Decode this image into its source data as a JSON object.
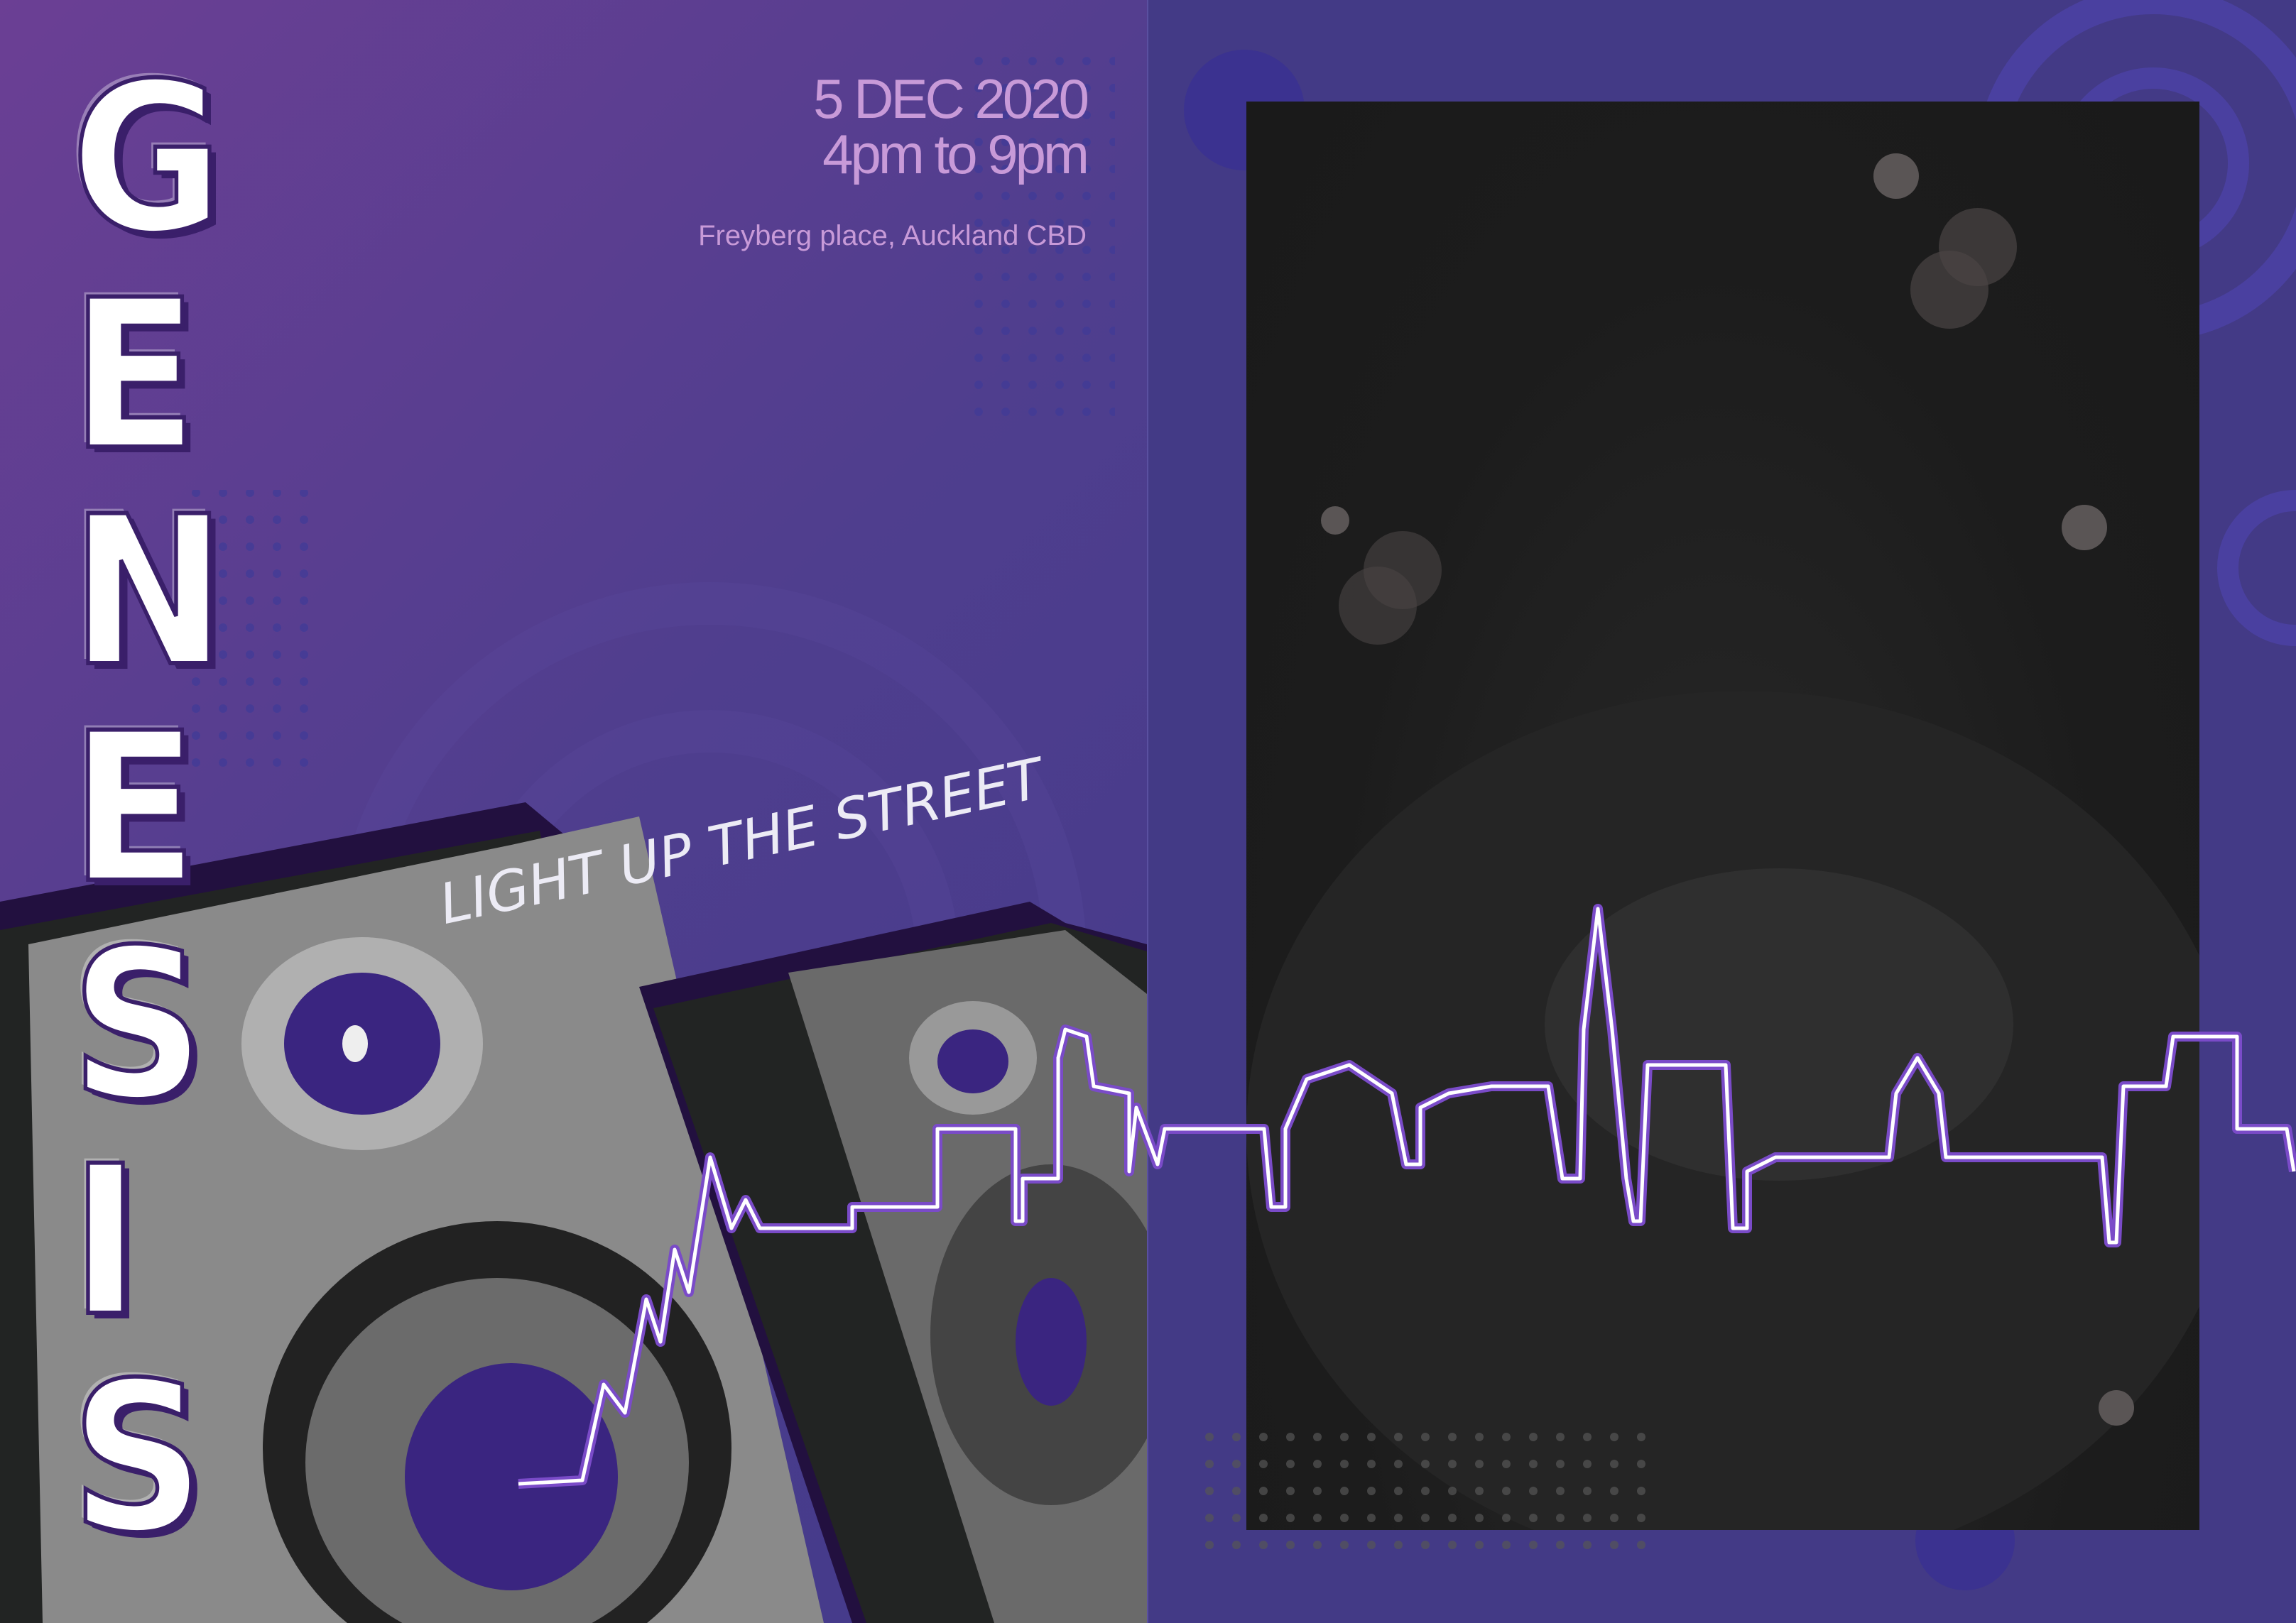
{
  "poster": {
    "title_letters": [
      "G",
      "E",
      "N",
      "E",
      "S",
      "I",
      "S"
    ],
    "date": "5 DEC 2020",
    "time": "4pm to 9pm",
    "venue": "Freyberg place, Auckland CBD",
    "tagline": "LIGHT UP THE STREET"
  },
  "colors": {
    "purple_top": "#6b3f94",
    "purple_bottom": "#433a86",
    "text_lilac": "#c89ad8",
    "photo_bg": "#1c1c1c",
    "speaker_purple": "#3a2580"
  }
}
